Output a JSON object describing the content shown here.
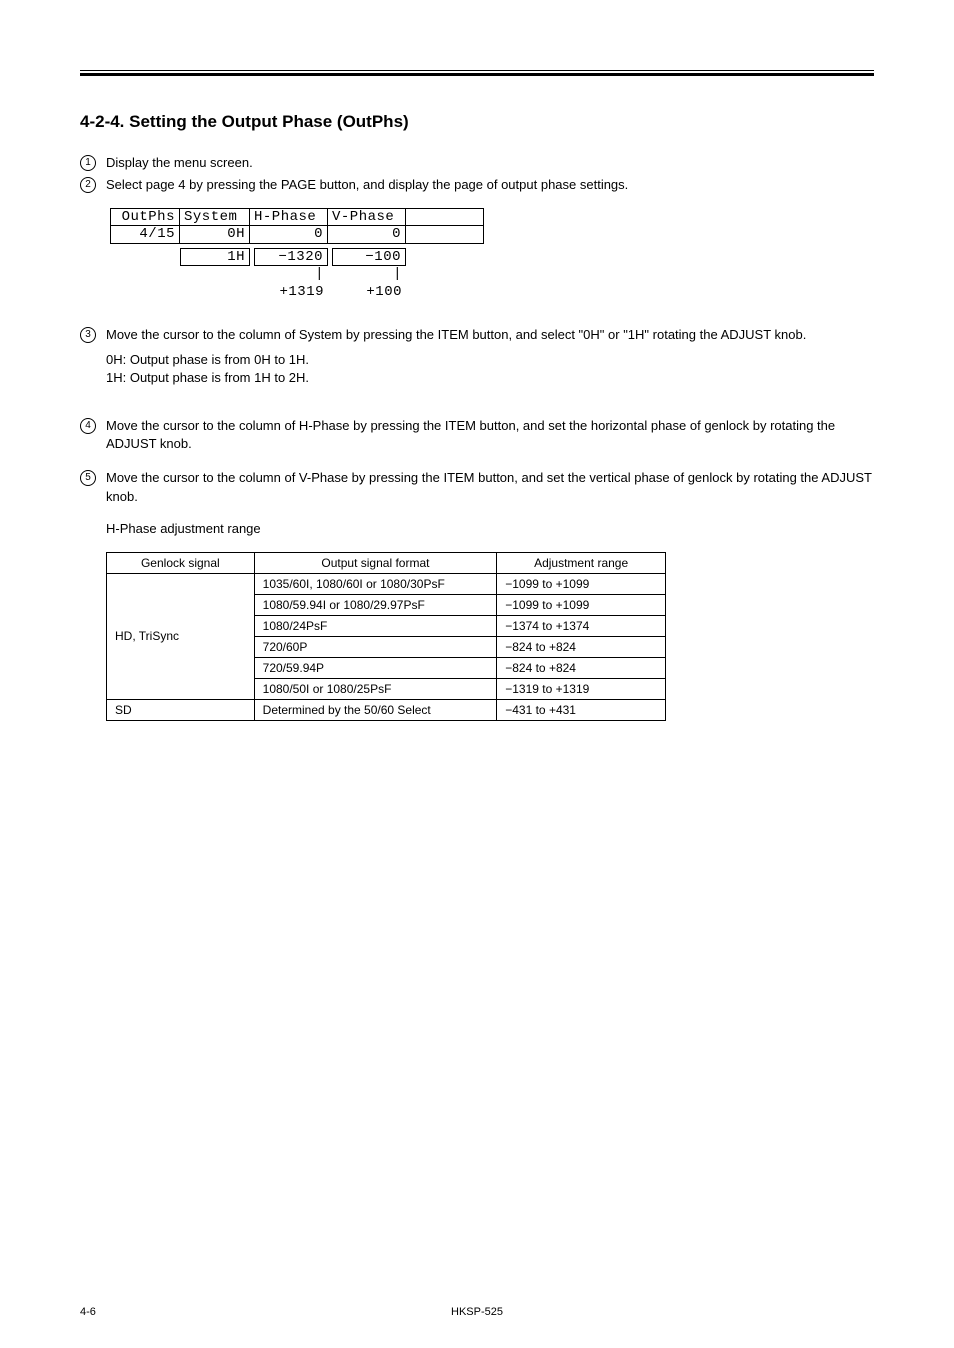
{
  "section_title": "4-2-4. Setting the Output Phase (OutPhs)",
  "steps": {
    "s1": "Display the menu screen.",
    "s2": "Select page 4 by pressing the PAGE button, and display the page of output phase settings.",
    "s3_a": "Move the cursor to the column of System by pressing the ITEM button, and select \"0H\" or \"1H\" rotating the ADJUST knob.",
    "s3_b": "0H: Output phase is from 0H to 1H.",
    "s3_c": "1H: Output phase is from 1H to 2H.",
    "s4": "Move the cursor to the column of H-Phase by pressing the ITEM button, and set the horizontal phase of genlock by rotating the ADJUST knob.",
    "s5": "Move the cursor to the column of V-Phase by pressing the ITEM button, and set the vertical phase of genlock by rotating the ADJUST knob."
  },
  "display": {
    "headers": [
      "OutPhs",
      "System",
      "H-Phase",
      "V-Phase",
      ""
    ],
    "values": [
      "4/15",
      "0H",
      "0",
      "0"
    ],
    "sub_system": "1H",
    "h_min": "−1320",
    "h_max": "+1319",
    "v_min": "−100",
    "v_max": "+100"
  },
  "tbl": {
    "hdr": [
      "Genlock signal",
      "Output signal format",
      "Adjustment range"
    ],
    "rows": [
      [
        "HD, TriSync",
        "1035/60I, 1080/60I or 1080/30PsF",
        "−1099 to +1099"
      ],
      [
        "",
        "1080/59.94I or 1080/29.97PsF",
        "−1099 to +1099"
      ],
      [
        "",
        "1080/24PsF",
        "−1374 to +1374"
      ],
      [
        "",
        "720/60P",
        "−824 to +824"
      ],
      [
        "",
        "720/59.94P",
        "−824 to +824"
      ],
      [
        "",
        "1080/50I or 1080/25PsF",
        "−1319 to +1319"
      ],
      [
        "SD",
        "Determined by the 50/60 Select",
        "−431 to +431"
      ]
    ]
  },
  "h_range_caption": "H-Phase adjustment range",
  "footer": {
    "page": "4-6",
    "title": "HKSP-525"
  }
}
